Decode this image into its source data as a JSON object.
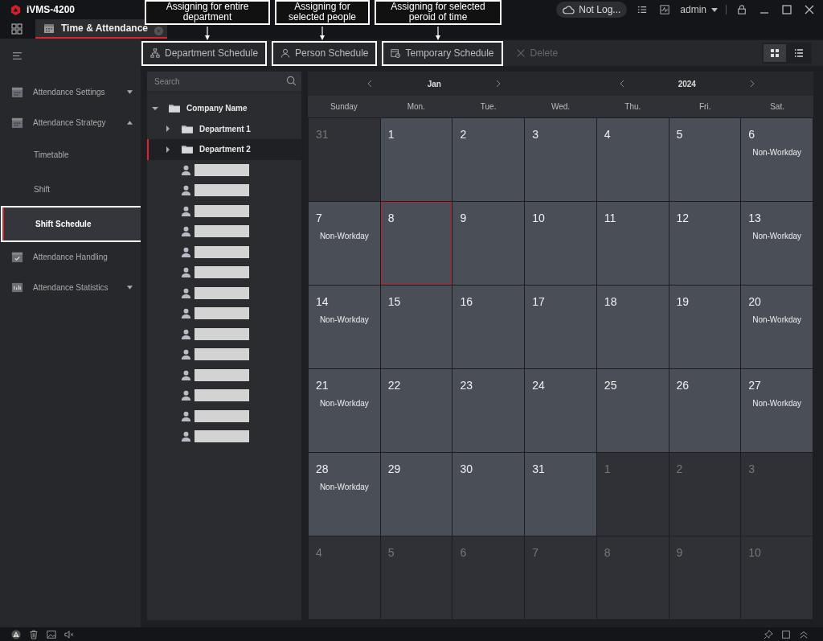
{
  "app": {
    "name": "iVMS-4200",
    "cloud_status": "Not Log...",
    "user": "admin"
  },
  "tabs": [
    {
      "label": "Time & Attendance",
      "selected": true
    }
  ],
  "callouts": [
    "Assigning for entire department",
    "Assigning for selected people",
    "Assigning for selected peroid of time"
  ],
  "toolbar": [
    {
      "kind": "department",
      "label": "Department Schedule",
      "disabled": false,
      "highlighted": true
    },
    {
      "kind": "person",
      "label": "Person Schedule",
      "disabled": false,
      "highlighted": true
    },
    {
      "kind": "temporary",
      "label": "Temporary Schedule",
      "disabled": false,
      "highlighted": true
    },
    {
      "kind": "delete",
      "label": "Delete",
      "disabled": true,
      "highlighted": false
    }
  ],
  "view_modes": [
    {
      "kind": "grid",
      "selected": true
    },
    {
      "kind": "list",
      "selected": false
    }
  ],
  "sidebar": {
    "items": [
      {
        "kind": "group",
        "label": "Attendance Settings",
        "expanded": false,
        "selected": false,
        "highlighted": false
      },
      {
        "kind": "group",
        "label": "Attendance Strategy",
        "expanded": true,
        "selected": false,
        "highlighted": false
      },
      {
        "kind": "child",
        "label": "Timetable",
        "selected": false,
        "highlighted": false
      },
      {
        "kind": "child",
        "label": "Shift",
        "selected": false,
        "highlighted": false
      },
      {
        "kind": "child",
        "label": "Shift Schedule",
        "selected": true,
        "highlighted": true
      },
      {
        "kind": "leaf",
        "label": "Attendance Handling",
        "selected": false,
        "highlighted": false
      },
      {
        "kind": "group",
        "label": "Attendance Statistics",
        "expanded": false,
        "selected": false,
        "highlighted": false
      }
    ]
  },
  "tree": {
    "search": {
      "placeholder": "Search"
    },
    "root": {
      "label": "Company Name",
      "expanded": true,
      "children": [
        {
          "label": "Department 1",
          "expanded": false,
          "selected": false
        },
        {
          "label": "Department 2",
          "expanded": false,
          "selected": true
        }
      ]
    },
    "people": [
      {
        "kind": "redacted"
      },
      {
        "kind": "redacted"
      },
      {
        "kind": "redacted"
      },
      {
        "kind": "redacted"
      },
      {
        "kind": "redacted"
      },
      {
        "kind": "redacted"
      },
      {
        "kind": "redacted"
      },
      {
        "kind": "redacted"
      },
      {
        "kind": "redacted"
      },
      {
        "kind": "redacted"
      },
      {
        "kind": "redacted"
      },
      {
        "kind": "redacted"
      },
      {
        "kind": "redacted"
      },
      {
        "kind": "redacted"
      }
    ]
  },
  "calendar": {
    "month": "Jan",
    "year": "2024",
    "weekdays": [
      "Sunday",
      "Mon.",
      "Tue.",
      "Wed.",
      "Thu.",
      "Fri.",
      "Sat."
    ],
    "weeks": [
      [
        {
          "day": "31",
          "in_month": false,
          "selected": false
        },
        {
          "day": "1",
          "in_month": true,
          "selected": false
        },
        {
          "day": "2",
          "in_month": true,
          "selected": false
        },
        {
          "day": "3",
          "in_month": true,
          "selected": false
        },
        {
          "day": "4",
          "in_month": true,
          "selected": false
        },
        {
          "day": "5",
          "in_month": true,
          "selected": false
        },
        {
          "day": "6",
          "in_month": true,
          "selected": false,
          "note": "Non-Workday"
        }
      ],
      [
        {
          "day": "7",
          "in_month": true,
          "selected": false,
          "note": "Non-Workday"
        },
        {
          "day": "8",
          "in_month": true,
          "selected": true
        },
        {
          "day": "9",
          "in_month": true,
          "selected": false
        },
        {
          "day": "10",
          "in_month": true,
          "selected": false
        },
        {
          "day": "11",
          "in_month": true,
          "selected": false
        },
        {
          "day": "12",
          "in_month": true,
          "selected": false
        },
        {
          "day": "13",
          "in_month": true,
          "selected": false,
          "note": "Non-Workday"
        }
      ],
      [
        {
          "day": "14",
          "in_month": true,
          "selected": false,
          "note": "Non-Workday"
        },
        {
          "day": "15",
          "in_month": true,
          "selected": false
        },
        {
          "day": "16",
          "in_month": true,
          "selected": false
        },
        {
          "day": "17",
          "in_month": true,
          "selected": false
        },
        {
          "day": "18",
          "in_month": true,
          "selected": false
        },
        {
          "day": "19",
          "in_month": true,
          "selected": false
        },
        {
          "day": "20",
          "in_month": true,
          "selected": false,
          "note": "Non-Workday"
        }
      ],
      [
        {
          "day": "21",
          "in_month": true,
          "selected": false,
          "note": "Non-Workday"
        },
        {
          "day": "22",
          "in_month": true,
          "selected": false
        },
        {
          "day": "23",
          "in_month": true,
          "selected": false
        },
        {
          "day": "24",
          "in_month": true,
          "selected": false
        },
        {
          "day": "25",
          "in_month": true,
          "selected": false
        },
        {
          "day": "26",
          "in_month": true,
          "selected": false
        },
        {
          "day": "27",
          "in_month": true,
          "selected": false,
          "note": "Non-Workday"
        }
      ],
      [
        {
          "day": "28",
          "in_month": true,
          "selected": false,
          "note": "Non-Workday"
        },
        {
          "day": "29",
          "in_month": true,
          "selected": false
        },
        {
          "day": "30",
          "in_month": true,
          "selected": false
        },
        {
          "day": "31",
          "in_month": true,
          "selected": false
        },
        {
          "day": "1",
          "in_month": false,
          "selected": false
        },
        {
          "day": "2",
          "in_month": false,
          "selected": false
        },
        {
          "day": "3",
          "in_month": false,
          "selected": false
        }
      ],
      [
        {
          "day": "4",
          "in_month": false,
          "selected": false
        },
        {
          "day": "5",
          "in_month": false,
          "selected": false
        },
        {
          "day": "6",
          "in_month": false,
          "selected": false
        },
        {
          "day": "7",
          "in_month": false,
          "selected": false
        },
        {
          "day": "8",
          "in_month": false,
          "selected": false
        },
        {
          "day": "9",
          "in_month": false,
          "selected": false
        },
        {
          "day": "10",
          "in_month": false,
          "selected": false
        }
      ]
    ]
  }
}
